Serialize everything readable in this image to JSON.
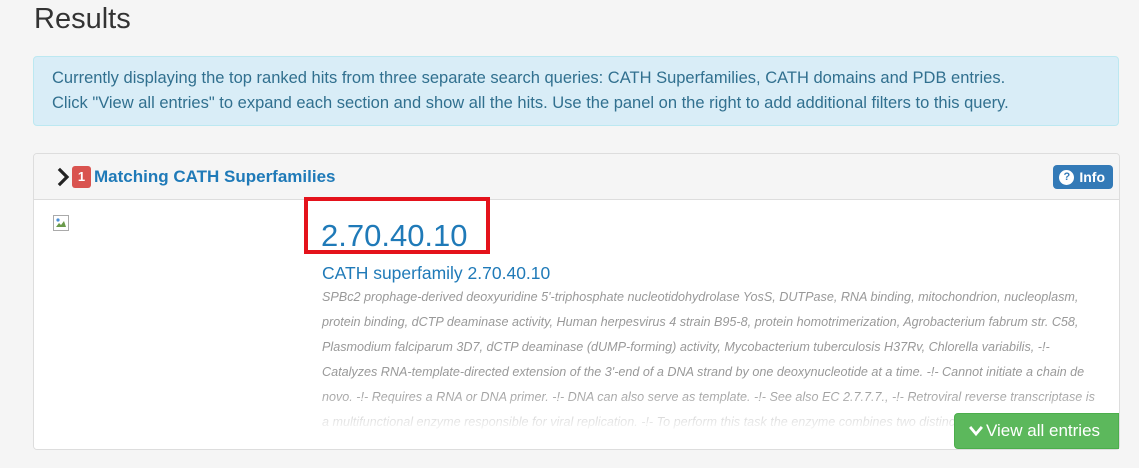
{
  "page": {
    "title": "Results"
  },
  "alert": {
    "line1": "Currently displaying the top ranked hits from three separate search queries: CATH Superfamilies, CATH domains and PDB entries.",
    "line2": "Click \"View all entries\" to expand each section and show all the hits. Use the panel on the right to add additional filters to this query."
  },
  "superfamilies": {
    "count": "1",
    "title": "Matching CATH Superfamilies",
    "info_label": "Info",
    "info_icon": "question-circle-icon",
    "expand_icon": "chevron-right-icon",
    "result": {
      "id": "2.70.40.10",
      "name": "CATH superfamily 2.70.40.10",
      "description": "SPBc2 prophage-derived deoxyuridine 5'-triphosphate nucleotidohydrolase YosS, DUTPase, RNA binding, mitochondrion, nucleoplasm, protein binding, dCTP deaminase activity, Human herpesvirus 4 strain B95-8, protein homotrimerization, Agrobacterium fabrum str. C58, Plasmodium falciparum 3D7, dCTP deaminase (dUMP-forming) activity, Mycobacterium tuberculosis H37Rv, Chlorella variabilis, -!- Catalyzes RNA-template-directed extension of the 3'-end of a DNA strand by one deoxynucleotide at a time. -!- Cannot initiate a chain de novo. -!- Requires a RNA or DNA primer. -!- DNA can also serve as template. -!- See also EC 2.7.7.7., -!- Retroviral reverse transcriptase is a multifunctional enzyme responsible for viral replication. -!- To perform this task the enzyme combines two distinct activities."
    },
    "view_all_label": "View all entries",
    "view_all_icon": "chevron-down-icon"
  },
  "colors": {
    "link": "#1f7ab8",
    "badge": "#d9534f",
    "info_button": "#337ab7",
    "success": "#5cb85c",
    "highlight": "#e4121b",
    "alert_bg": "#d9edf7",
    "alert_text": "#31708f"
  }
}
